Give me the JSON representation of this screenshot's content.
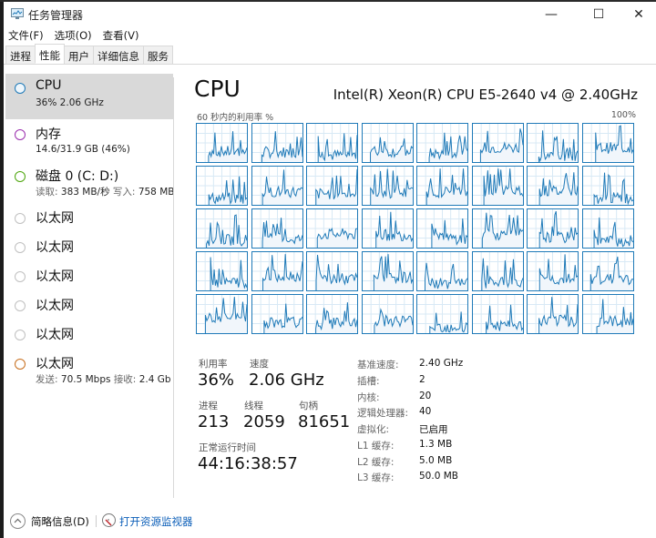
{
  "window": {
    "title": "任务管理器",
    "controls": {
      "minimize": "—",
      "maximize": "☐",
      "close": "✕"
    }
  },
  "menu": [
    "文件(F)",
    "选项(O)",
    "查看(V)"
  ],
  "tabs": [
    {
      "label": "进程",
      "active": false
    },
    {
      "label": "性能",
      "active": true
    },
    {
      "label": "用户",
      "active": false
    },
    {
      "label": "详细信息",
      "active": false
    },
    {
      "label": "服务",
      "active": false
    }
  ],
  "sidebar": {
    "items": [
      {
        "label": "CPU",
        "sub": "36% 2.06 GHz",
        "color": "#1f7ab8",
        "selected": true
      },
      {
        "label": "内存",
        "sub": "14.6/31.9 GB (46%)",
        "color": "#9b2fae"
      },
      {
        "label": "磁盘 0 (C: D:)",
        "sub_label1": "读取:",
        "sub_value1": "383 MB/秒",
        "sub_label2": "写入:",
        "sub_value2": "758 MB",
        "color": "#4da60c"
      },
      {
        "label": "以太网",
        "color": "#c0c0c0"
      },
      {
        "label": "以太网",
        "color": "#c0c0c0"
      },
      {
        "label": "以太网",
        "color": "#c0c0c0"
      },
      {
        "label": "以太网",
        "color": "#c0c0c0"
      },
      {
        "label": "以太网",
        "color": "#c0c0c0"
      },
      {
        "label": "以太网",
        "sub_label1": "发送:",
        "sub_value1": "70.5 Mbps",
        "sub_label2": "接收:",
        "sub_value2": "2.4 Gb",
        "color": "#c76e1d"
      }
    ]
  },
  "main": {
    "title": "CPU",
    "model": "Intel(R) Xeon(R) CPU E5-2640 v4 @ 2.40GHz",
    "util_label": "60 秒内的利用率 %",
    "util_max": "100%",
    "logical_processor_graphs": 40,
    "graph_line_color": "#1f7ab8",
    "stats": {
      "utilization_label": "利用率",
      "utilization": "36%",
      "speed_label": "速度",
      "speed": "2.06 GHz",
      "processes_label": "进程",
      "processes": "213",
      "threads_label": "线程",
      "threads": "2059",
      "handles_label": "句柄",
      "handles": "81651",
      "uptime_label": "正常运行时间",
      "uptime": "44:16:38:57"
    },
    "specs": [
      {
        "label": "基准速度:",
        "value": "2.40 GHz"
      },
      {
        "label": "插槽:",
        "value": "2"
      },
      {
        "label": "内核:",
        "value": "20"
      },
      {
        "label": "逻辑处理器:",
        "value": "40"
      },
      {
        "label": "虚拟化:",
        "value": "已启用"
      },
      {
        "label": "L1 缓存:",
        "value": "1.3 MB"
      },
      {
        "label": "L2 缓存:",
        "value": "5.0 MB"
      },
      {
        "label": "L3 缓存:",
        "value": "50.0 MB"
      }
    ]
  },
  "footer": {
    "fewer_details": "简略信息(D)",
    "open_resmon": "打开资源监视器"
  }
}
